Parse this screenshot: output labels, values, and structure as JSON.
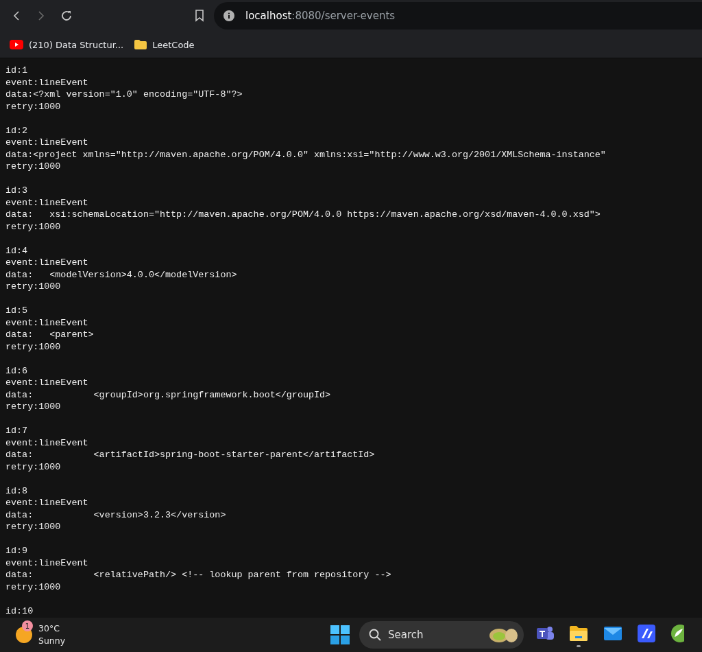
{
  "browser": {
    "nav": {
      "back_disabled": false,
      "forward_disabled": true
    },
    "url": {
      "host": "localhost",
      "path": ":8080/server-events"
    },
    "bookmarks": [
      {
        "kind": "video",
        "label": "(210) Data Structur..."
      },
      {
        "kind": "folder",
        "label": "LeetCode"
      }
    ]
  },
  "events": [
    {
      "lines": [
        "id:1",
        "event:lineEvent",
        "data:<?xml version=\"1.0\" encoding=\"UTF-8\"?>",
        "retry:1000"
      ]
    },
    {
      "lines": [
        "id:2",
        "event:lineEvent",
        "data:<project xmlns=\"http://maven.apache.org/POM/4.0.0\" xmlns:xsi=\"http://www.w3.org/2001/XMLSchema-instance\"",
        "retry:1000"
      ]
    },
    {
      "lines": [
        "id:3",
        "event:lineEvent",
        "data:   xsi:schemaLocation=\"http://maven.apache.org/POM/4.0.0 https://maven.apache.org/xsd/maven-4.0.0.xsd\">",
        "retry:1000"
      ]
    },
    {
      "lines": [
        "id:4",
        "event:lineEvent",
        "data:   <modelVersion>4.0.0</modelVersion>",
        "retry:1000"
      ]
    },
    {
      "lines": [
        "id:5",
        "event:lineEvent",
        "data:   <parent>",
        "retry:1000"
      ]
    },
    {
      "lines": [
        "id:6",
        "event:lineEvent",
        "data:           <groupId>org.springframework.boot</groupId>",
        "retry:1000"
      ]
    },
    {
      "lines": [
        "id:7",
        "event:lineEvent",
        "data:           <artifactId>spring-boot-starter-parent</artifactId>",
        "retry:1000"
      ]
    },
    {
      "lines": [
        "id:8",
        "event:lineEvent",
        "data:           <version>3.2.3</version>",
        "retry:1000"
      ]
    },
    {
      "lines": [
        "id:9",
        "event:lineEvent",
        "data:           <relativePath/> <!-- lookup parent from repository -->",
        "retry:1000"
      ]
    },
    {
      "lines": [
        "id:10"
      ]
    }
  ],
  "taskbar": {
    "weather": {
      "badge": "1",
      "temperature": "30°C",
      "condition": "Sunny"
    },
    "search": {
      "placeholder": "Search"
    },
    "apps": [
      {
        "kind": "chat",
        "open": false
      },
      {
        "kind": "files",
        "open": true
      },
      {
        "kind": "mail",
        "open": false
      },
      {
        "kind": "editor",
        "open": false
      },
      {
        "kind": "leaf",
        "open": false
      }
    ]
  }
}
